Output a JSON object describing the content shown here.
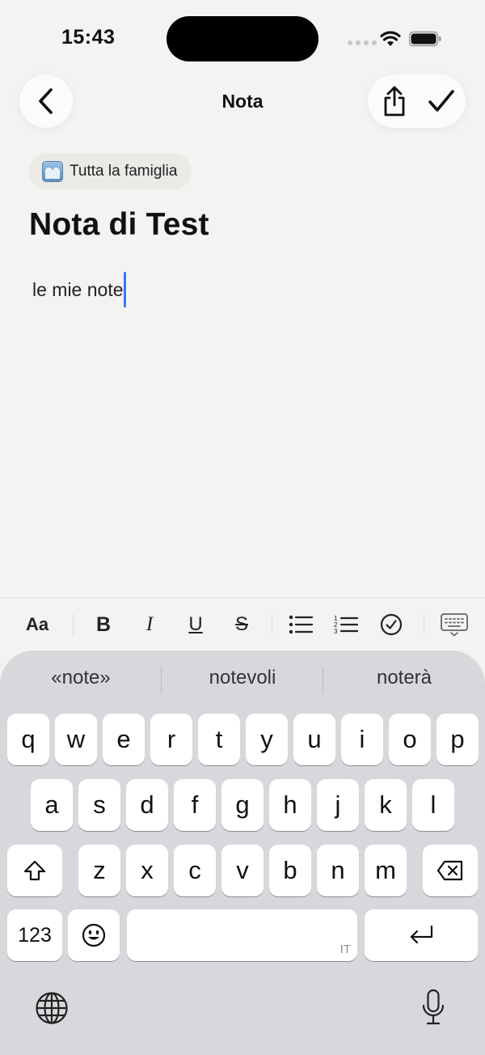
{
  "status": {
    "time": "15:43"
  },
  "nav": {
    "title": "Nota"
  },
  "note": {
    "audience": "Tutta la famiglia",
    "title": "Nota di Test",
    "body": "le mie note"
  },
  "toolbar": {
    "text_style": "Aa",
    "bold": "B",
    "italic": "I",
    "underline": "U",
    "strike": "S"
  },
  "keyboard": {
    "suggestions": [
      "«note»",
      "notevoli",
      "noterà"
    ],
    "rows": [
      [
        "q",
        "w",
        "e",
        "r",
        "t",
        "y",
        "u",
        "i",
        "o",
        "p"
      ],
      [
        "a",
        "s",
        "d",
        "f",
        "g",
        "h",
        "j",
        "k",
        "l"
      ],
      [
        "z",
        "x",
        "c",
        "v",
        "b",
        "n",
        "m"
      ]
    ],
    "numbers_key": "123",
    "space_language": "IT"
  },
  "colors": {
    "background": "#f4f3f1",
    "caret": "#3478f6",
    "keyboard": "#d6d8dc"
  }
}
